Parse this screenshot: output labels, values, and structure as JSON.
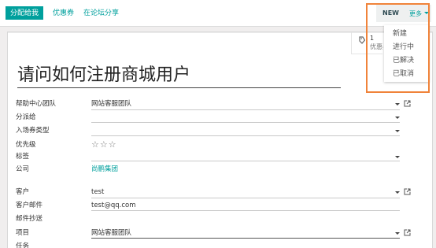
{
  "toolbar": {
    "assign_to_me": "分配给我",
    "coupon": "优惠券",
    "share_forum": "在论坛分享"
  },
  "status": {
    "current": "NEW",
    "more": "更多"
  },
  "status_menu": {
    "items": [
      "新建",
      "进行中",
      "已解决",
      "已取消"
    ]
  },
  "stat_button": {
    "count": "1",
    "label": "优惠券"
  },
  "record": {
    "title": "请问如何注册商城用户"
  },
  "fields": {
    "helpdesk_team": {
      "label": "帮助中心团队",
      "value": "网站客服团队"
    },
    "assigned_to": {
      "label": "分派给",
      "value": ""
    },
    "ticket_type": {
      "label": "入场券类型",
      "value": ""
    },
    "priority": {
      "label": "优先级",
      "value": "☆☆☆"
    },
    "tags": {
      "label": "标签",
      "value": ""
    },
    "company": {
      "label": "公司",
      "value": "尚鹏集团"
    },
    "customer": {
      "label": "客户",
      "value": "test"
    },
    "customer_email": {
      "label": "客户邮件",
      "value": "test@qq.com"
    },
    "email_cc": {
      "label": "邮件抄送",
      "value": ""
    },
    "project": {
      "label": "项目",
      "value": "网站客服团队"
    },
    "task": {
      "label": "任务",
      "value": ""
    }
  },
  "colors": {
    "accent": "#00a09d",
    "highlight": "#f0833a"
  }
}
